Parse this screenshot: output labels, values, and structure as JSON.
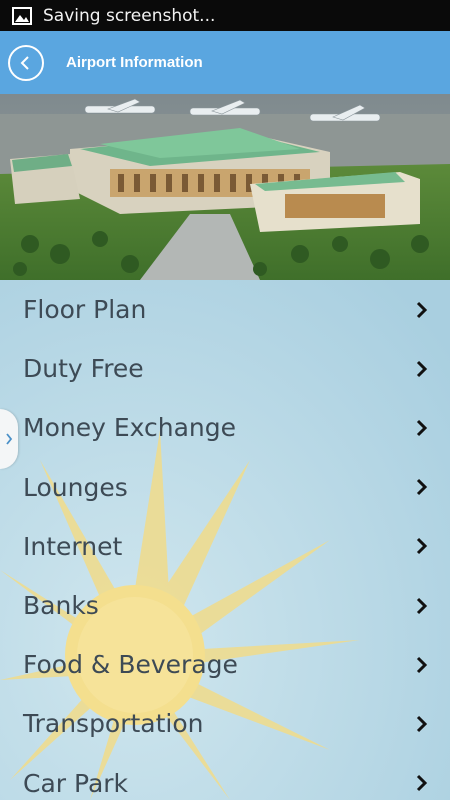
{
  "status_bar": {
    "text": "Saving screenshot...",
    "icon": "image-icon"
  },
  "app_bar": {
    "title": "Airport Information",
    "back_icon": "chevron-left-icon",
    "color": "#5aa6e0"
  },
  "menu": {
    "items": [
      {
        "label": "Floor Plan"
      },
      {
        "label": "Duty Free"
      },
      {
        "label": "Money Exchange"
      },
      {
        "label": "Lounges"
      },
      {
        "label": "Internet"
      },
      {
        "label": "Banks"
      },
      {
        "label": "Food & Beverage"
      },
      {
        "label": "Transportation"
      },
      {
        "label": "Car Park"
      }
    ],
    "item_icon": "chevron-right-icon"
  },
  "drawer_handle": {
    "icon": "chevron-right-icon"
  }
}
